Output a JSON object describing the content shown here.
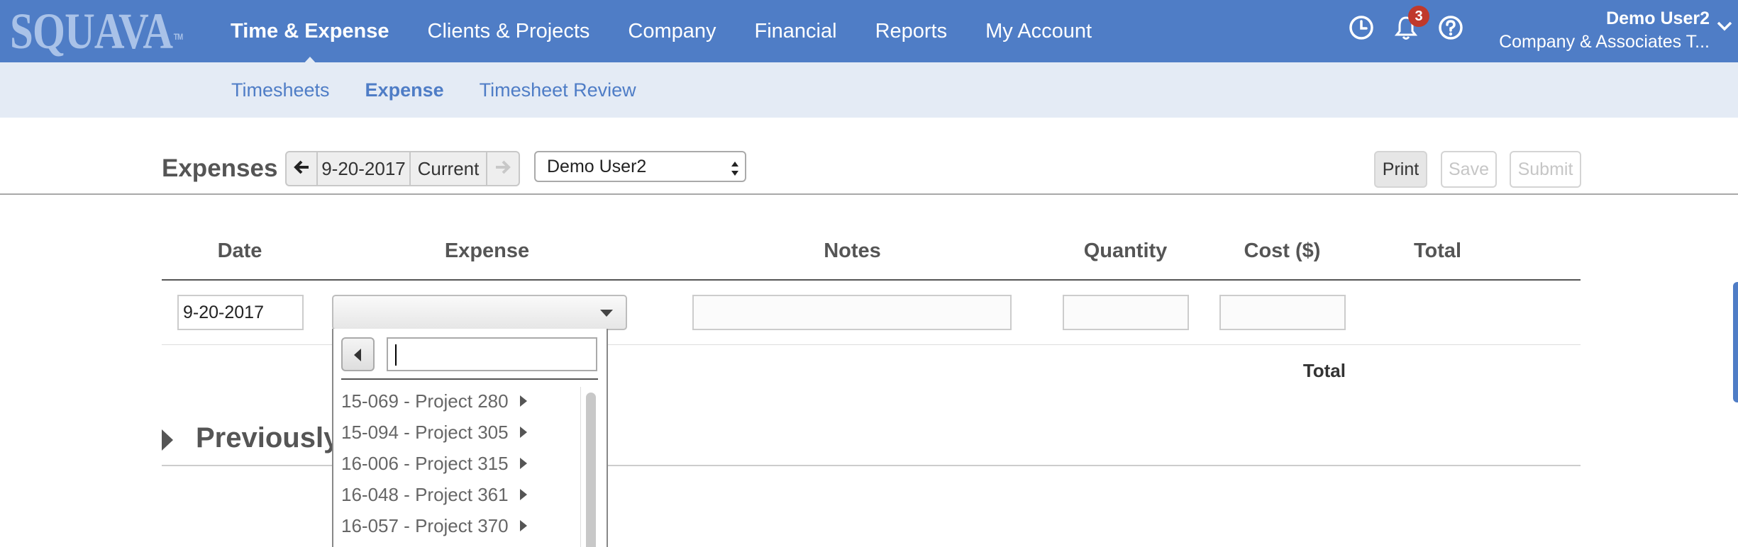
{
  "brand": {
    "logo_text": "SQUAVA",
    "trademark": "TM"
  },
  "main_nav": [
    {
      "label": "Time & Expense",
      "active": true
    },
    {
      "label": "Clients & Projects",
      "active": false
    },
    {
      "label": "Company",
      "active": false
    },
    {
      "label": "Financial",
      "active": false
    },
    {
      "label": "Reports",
      "active": false
    },
    {
      "label": "My Account",
      "active": false
    }
  ],
  "top_icons": {
    "clock": "clock-icon",
    "bell": "bell-icon",
    "help": "help-icon",
    "notification_count": "3"
  },
  "user": {
    "name": "Demo User2",
    "company": "Company & Associates T..."
  },
  "sub_nav": [
    {
      "label": "Timesheets",
      "active": false
    },
    {
      "label": "Expense",
      "active": true
    },
    {
      "label": "Timesheet Review",
      "active": false
    }
  ],
  "toolbar": {
    "title": "Expenses",
    "date": "9-20-2017",
    "current_label": "Current",
    "user_select": "Demo User2",
    "print_label": "Print",
    "save_label": "Save",
    "submit_label": "Submit"
  },
  "table": {
    "headers": [
      "Date",
      "Expense",
      "Notes",
      "Quantity",
      "Cost ($)",
      "Total"
    ],
    "row": {
      "date": "9-20-2017",
      "expense": "",
      "notes": "",
      "quantity": "",
      "cost": ""
    },
    "total_label": "Total"
  },
  "previously_section": {
    "title": "Previously"
  },
  "dropdown": {
    "search_value": "",
    "items": [
      "15-069 - Project 280",
      "15-094 - Project 305",
      "16-006 - Project 315",
      "16-048 - Project 361",
      "16-057 - Project 370"
    ]
  },
  "colors": {
    "nav_blue": "#4f7dc6",
    "subnav_bg": "#e4ebf5",
    "badge_red": "#c0392b"
  }
}
